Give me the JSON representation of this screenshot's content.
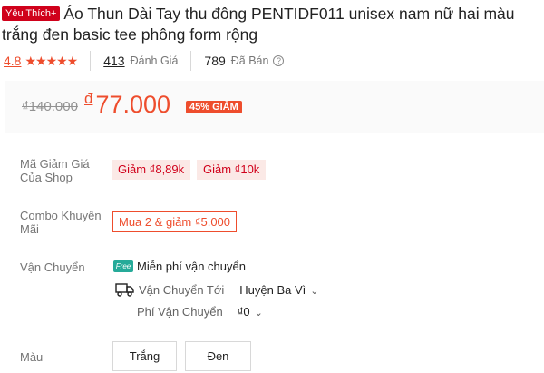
{
  "product": {
    "badge": "Yêu Thích+",
    "title": "Áo Thun Dài Tay thu đông PENTIDF011 unisex nam nữ hai màu trắng đen basic tee phông form rộng"
  },
  "stats": {
    "rating": "4.8",
    "stars": "★★★★★",
    "reviews_count": "413",
    "reviews_label": "Đánh Giá",
    "sold_count": "789",
    "sold_label": "Đã Bán",
    "help_glyph": "?"
  },
  "price": {
    "original": "₫140.000",
    "currency": "đ",
    "current": "77.000",
    "discount": "45% GIẢM"
  },
  "vouchers": {
    "label": "Mã Giảm Giá Của Shop",
    "items": [
      "Giảm ₫8,89k",
      "Giảm ₫10k"
    ]
  },
  "combo": {
    "label": "Combo Khuyến Mãi",
    "offer": "Mua 2 & giảm ₫5.000"
  },
  "shipping": {
    "label": "Vận Chuyển",
    "free_badge": "Free",
    "free_text": "Miễn phí vận chuyển",
    "to_label": "Vận Chuyển Tới",
    "to_value": "Huyện Ba Vì",
    "fee_label": "Phí Vận Chuyển",
    "fee_value": "₫0"
  },
  "color": {
    "label": "Màu",
    "options": [
      "Trắng",
      "Đen"
    ]
  }
}
